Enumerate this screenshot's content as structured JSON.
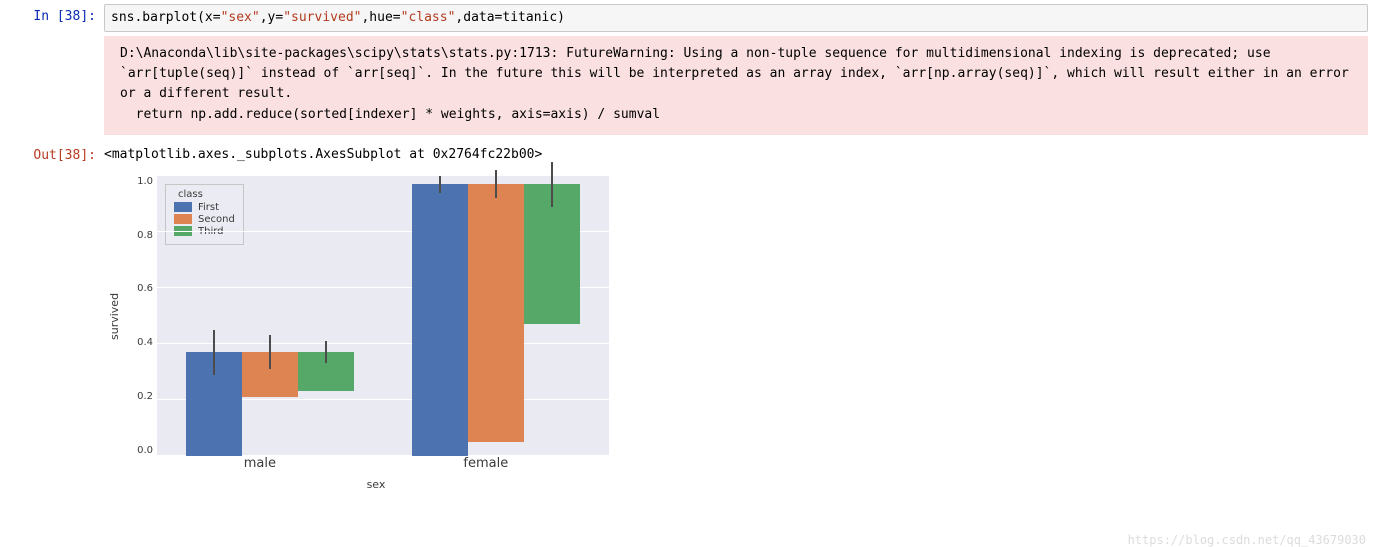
{
  "cell": {
    "in_prompt": "In  [38]:",
    "out_prompt": "Out[38]:",
    "code_prefix": "sns.barplot(x=",
    "code_str_x": "\"sex\"",
    "code_mid1": ",y=",
    "code_str_y": "\"survived\"",
    "code_mid2": ",hue=",
    "code_str_h": "\"class\"",
    "code_suffix": ",data=titanic)",
    "stderr": "D:\\Anaconda\\lib\\site-packages\\scipy\\stats\\stats.py:1713: FutureWarning: Using a non-tuple sequence for multidimensional indexing is deprecated; use `arr[tuple(seq)]` instead of `arr[seq]`. In the future this will be interpreted as an array index, `arr[np.array(seq)]`, which will result either in an error or a different result.\n  return np.add.reduce(sorted[indexer] * weights, axis=axis) / sumval",
    "repr": "<matplotlib.axes._subplots.AxesSubplot at 0x2764fc22b00>"
  },
  "chart_data": {
    "type": "bar",
    "categories": [
      "male",
      "female"
    ],
    "series": [
      {
        "name": "First",
        "values": [
          0.37,
          0.97
        ],
        "err": [
          0.08,
          0.03
        ]
      },
      {
        "name": "Second",
        "values": [
          0.16,
          0.92
        ],
        "err": [
          0.06,
          0.05
        ]
      },
      {
        "name": "Third",
        "values": [
          0.14,
          0.5
        ],
        "err": [
          0.04,
          0.08
        ]
      }
    ],
    "yticks": [
      "1.0",
      "0.8",
      "0.6",
      "0.4",
      "0.2",
      "0.0"
    ],
    "ylim": [
      0.0,
      1.0
    ],
    "xlabel": "sex",
    "ylabel": "survived",
    "legend_title": "class"
  },
  "watermark": "https://blog.csdn.net/qq_43679030"
}
